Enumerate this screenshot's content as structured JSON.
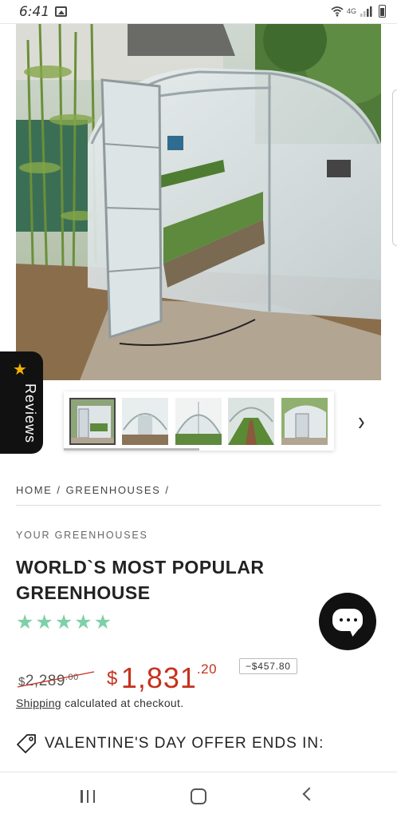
{
  "status": {
    "time": "6:41",
    "network": "4G"
  },
  "product": {
    "image_alt": "Polycarbonate greenhouse with open door",
    "thumbnail_count": 5,
    "breadcrumb": [
      "HOME",
      "GREENHOUSES"
    ],
    "breadcrumb_sep": "/",
    "vendor": "YOUR GREENHOUSES",
    "title": "WORLD`S MOST POPULAR GREENHOUSE",
    "rating": 5,
    "compare_price": {
      "currency": "$",
      "main": "2,289",
      "cents": ".00"
    },
    "sale_price": {
      "currency": "$",
      "main": "1,831",
      "cents": ".20"
    },
    "savings": "−$457.80",
    "shipping_link": "Shipping",
    "shipping_text": " calculated at checkout.",
    "offer_text": "VALENTINE'S DAY OFFER ENDS IN:"
  },
  "reviews_tab": {
    "label": "Reviews",
    "icon": "star-icon"
  },
  "colors": {
    "sale": "#c5321e",
    "stars": "#7fd0a8",
    "chat": "#111111",
    "reviews_star": "#f5b301"
  }
}
